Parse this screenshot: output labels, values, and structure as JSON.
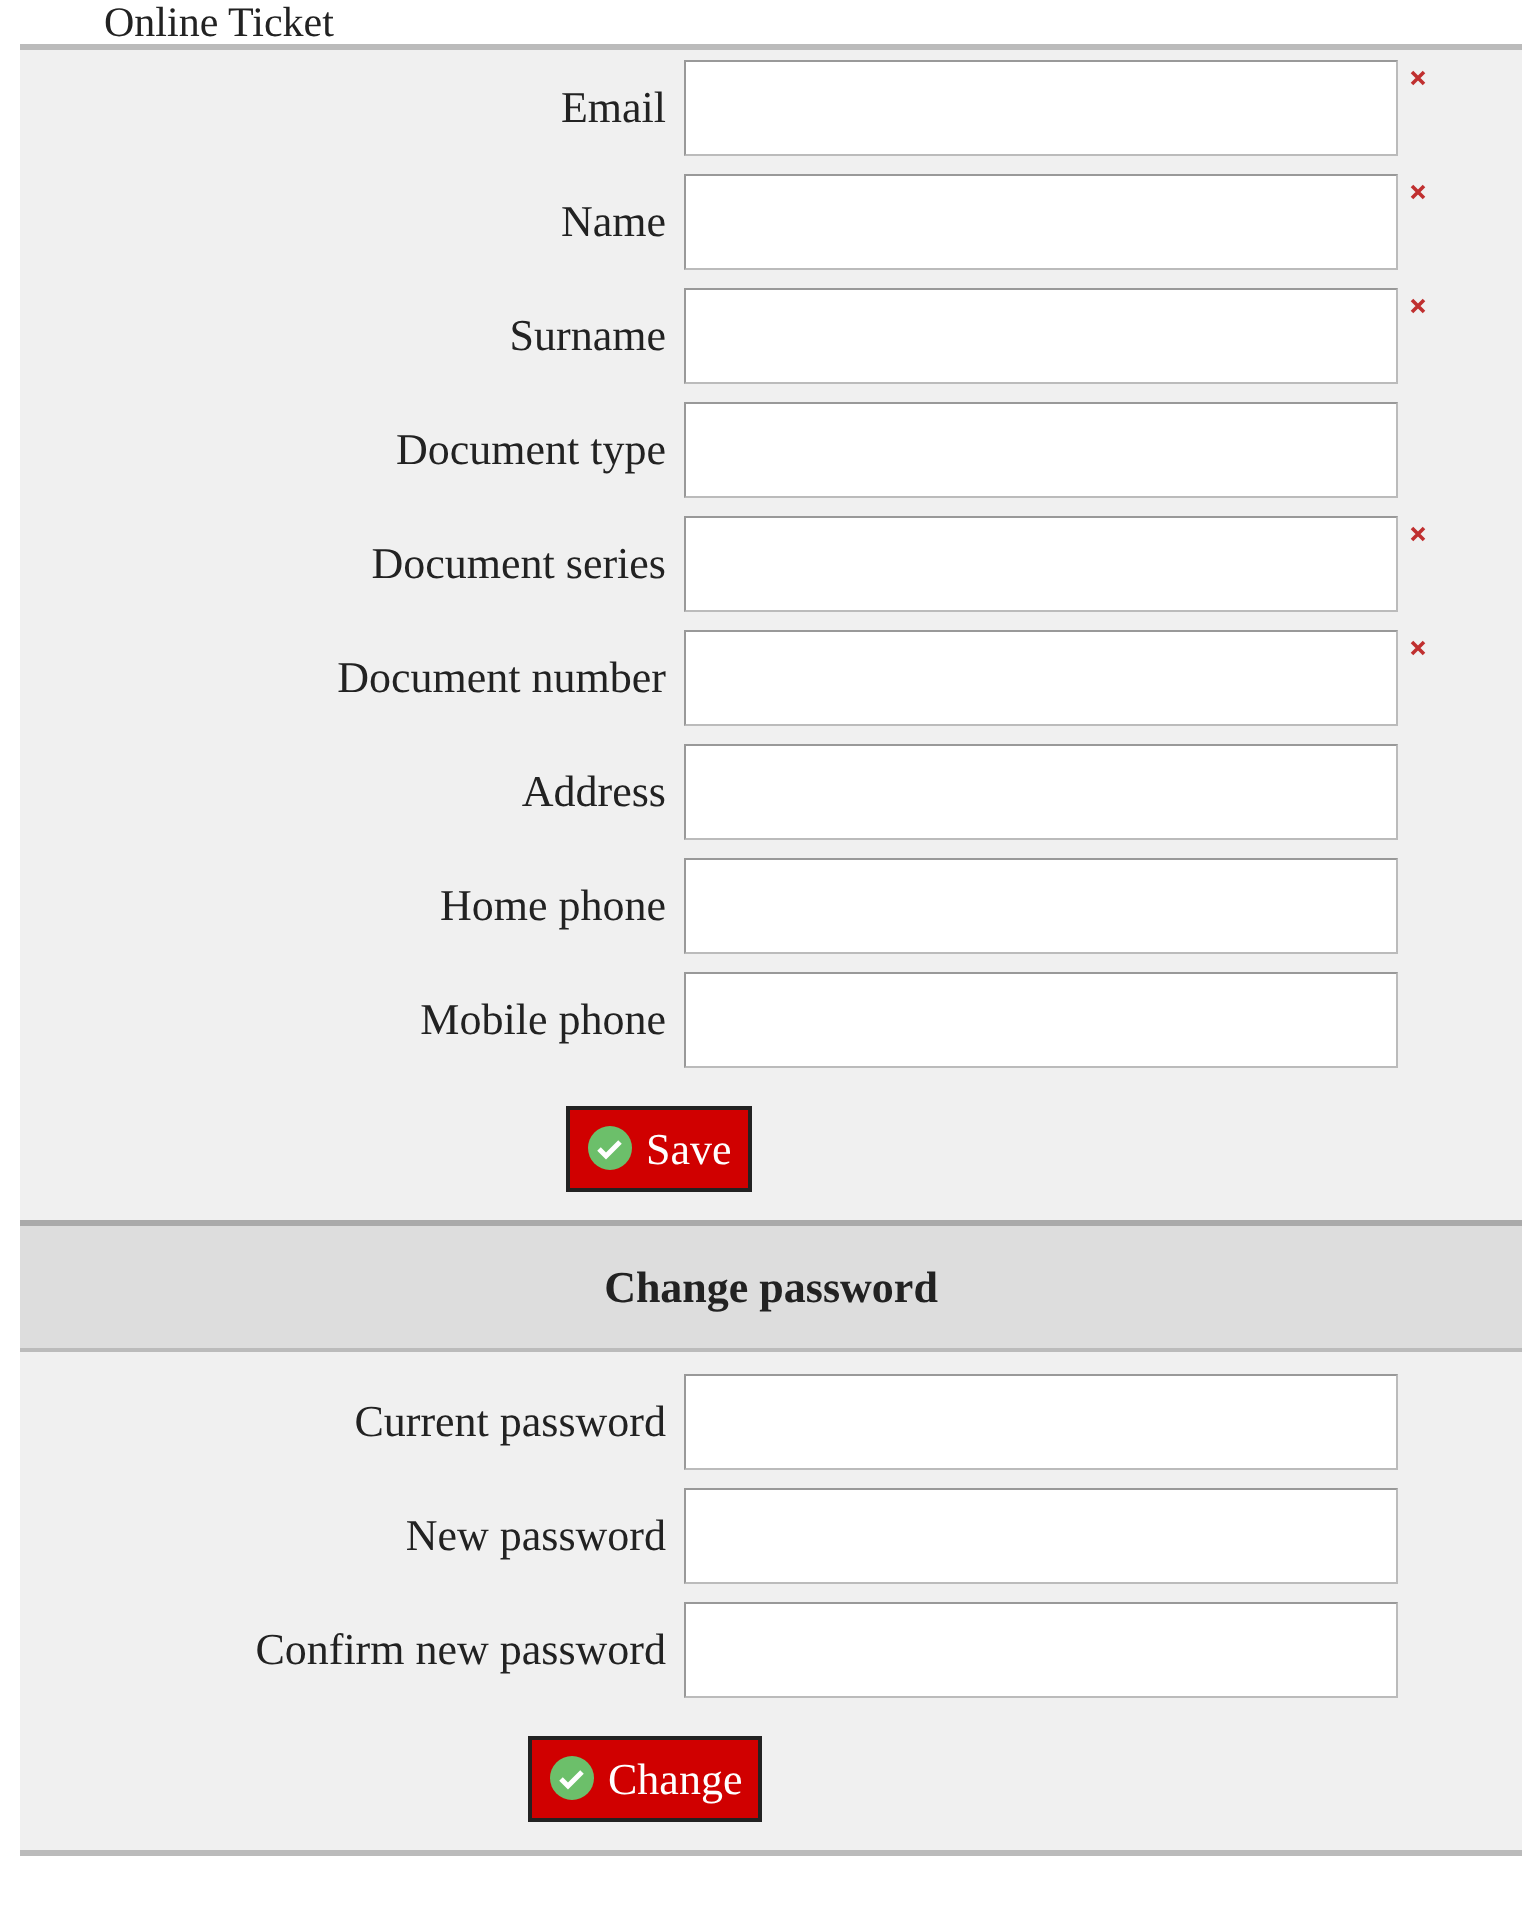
{
  "page_title": "Online Ticket",
  "profile_fields": [
    {
      "label": "Email",
      "required": true
    },
    {
      "label": "Name",
      "required": true
    },
    {
      "label": "Surname",
      "required": true
    },
    {
      "label": "Document type",
      "required": false
    },
    {
      "label": "Document series",
      "required": true
    },
    {
      "label": "Document number",
      "required": true
    },
    {
      "label": "Address",
      "required": false
    },
    {
      "label": "Home phone",
      "required": false
    },
    {
      "label": "Mobile phone",
      "required": false
    }
  ],
  "save_button": "Save",
  "password_section": {
    "title": "Change password",
    "fields": [
      {
        "label": "Current password"
      },
      {
        "label": "New password"
      },
      {
        "label": "Confirm new password"
      }
    ],
    "button": "Change"
  }
}
